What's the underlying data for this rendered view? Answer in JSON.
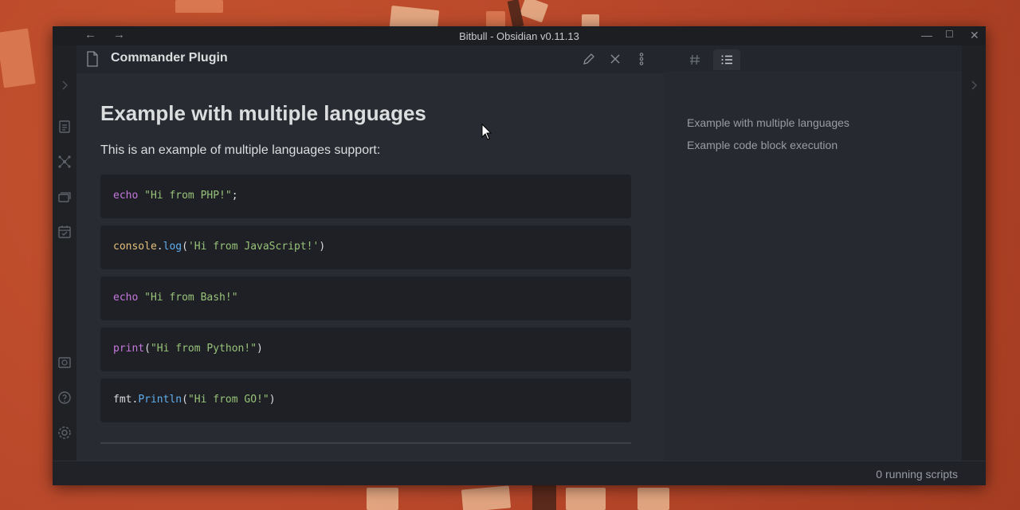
{
  "window": {
    "title": "Bitbull - Obsidian v0.11.13"
  },
  "titlebar": {
    "back_icon": "arrow-left-icon",
    "forward_icon": "arrow-right-icon",
    "minimize_label": "—",
    "maximize_label": "☐",
    "close_label": "✕"
  },
  "left_ribbon": {
    "icons": [
      "chevron-right-icon",
      "file-explorer-icon",
      "graph-view-icon",
      "cards-icon",
      "calendar-check-icon",
      "vault-icon",
      "help-icon",
      "settings-icon"
    ]
  },
  "editor": {
    "file_title": "Commander Plugin",
    "heading": "Example with multiple languages",
    "paragraph": "This is an example of multiple languages support:",
    "code_blocks": [
      {
        "tokens": [
          [
            "kw",
            "echo"
          ],
          [
            "plain",
            " "
          ],
          [
            "str",
            "\"Hi from PHP!\""
          ],
          [
            "plain",
            ";"
          ]
        ]
      },
      {
        "tokens": [
          [
            "id",
            "console"
          ],
          [
            "plain",
            "."
          ],
          [
            "fn",
            "log"
          ],
          [
            "plain",
            "("
          ],
          [
            "str",
            "'Hi from JavaScript!'"
          ],
          [
            "plain",
            ")"
          ]
        ]
      },
      {
        "tokens": [
          [
            "kw",
            "echo"
          ],
          [
            "plain",
            " "
          ],
          [
            "str",
            "\"Hi from Bash!\""
          ]
        ]
      },
      {
        "tokens": [
          [
            "kw",
            "print"
          ],
          [
            "plain",
            "("
          ],
          [
            "str",
            "\"Hi from Python!\""
          ],
          [
            "plain",
            ")"
          ]
        ]
      },
      {
        "tokens": [
          [
            "plain",
            "fmt"
          ],
          [
            "plain",
            "."
          ],
          [
            "fn",
            "Println"
          ],
          [
            "plain",
            "("
          ],
          [
            "str",
            "\"Hi from GO!\""
          ],
          [
            "plain",
            ")"
          ]
        ]
      }
    ]
  },
  "outline": {
    "items": [
      "Example with multiple languages",
      "Example code block execution"
    ]
  },
  "statusbar": {
    "text": "0 running scripts"
  },
  "colors": {
    "accent": "#c678dd",
    "string": "#98c379",
    "function": "#61afef",
    "identifier": "#e5c07b"
  }
}
